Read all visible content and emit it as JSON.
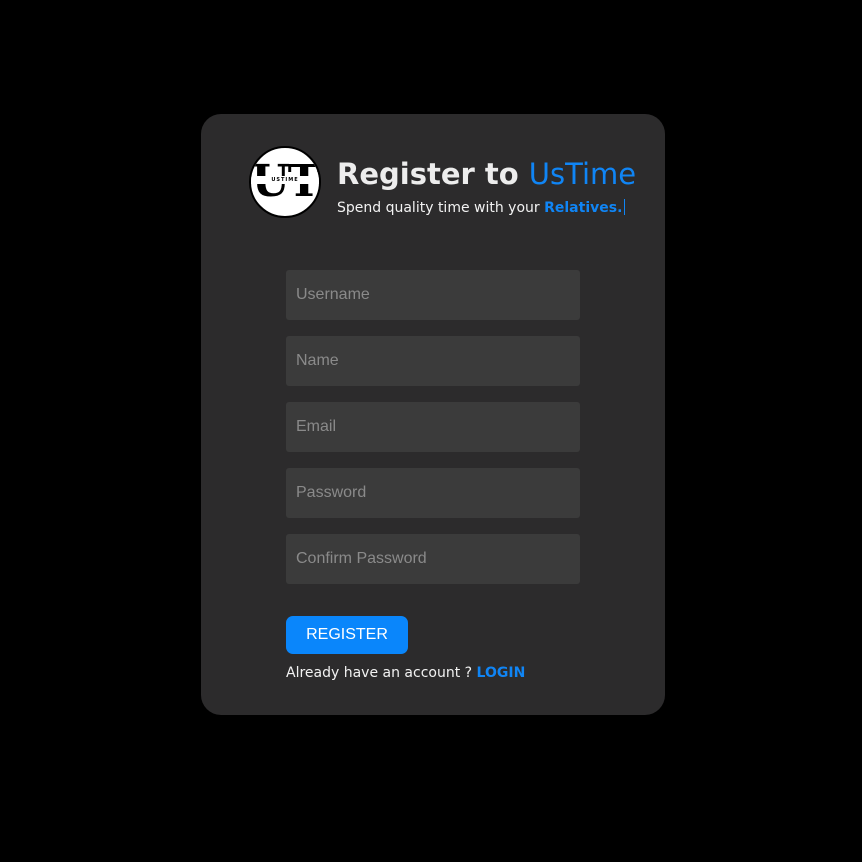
{
  "logo": {
    "letters": "UT",
    "caption": "USTIME"
  },
  "header": {
    "title_prefix": "Register to ",
    "title_brand": "UsTime",
    "subtitle_prefix": "Spend quality time with your ",
    "subtitle_accent": "Relatives."
  },
  "form": {
    "username_placeholder": "Username",
    "name_placeholder": "Name",
    "email_placeholder": "Email",
    "password_placeholder": "Password",
    "confirm_password_placeholder": "Confirm Password",
    "register_label": "REGISTER"
  },
  "footer": {
    "prompt": "Already have an account ? ",
    "login_label": "LOGIN"
  },
  "colors": {
    "background": "#000000",
    "card": "#2c2b2c",
    "input": "#3b3b3b",
    "accent": "#1085f5",
    "button": "#0a86fb"
  }
}
